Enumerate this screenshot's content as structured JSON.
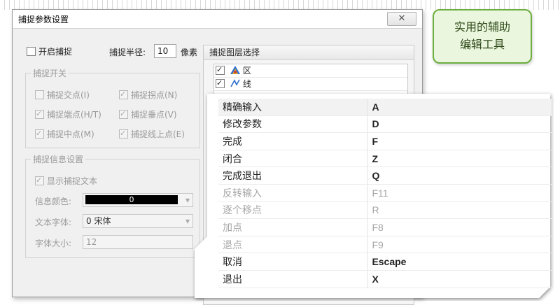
{
  "dialog": {
    "title": "捕捉参数设置",
    "close_label": "✕",
    "enable_snap_label": "开启捕捉",
    "radius_label": "捕捉半径:",
    "radius_value": "10",
    "radius_unit": "像素",
    "switch_group_label": "捕捉开关",
    "options": [
      {
        "label": "捕捉交点(I)",
        "checked": false
      },
      {
        "label": "捕捉拐点(N)",
        "checked": true
      },
      {
        "label": "捕捉端点(H/T)",
        "checked": true
      },
      {
        "label": "捕捉垂点(V)",
        "checked": true
      },
      {
        "label": "捕捉中点(M)",
        "checked": true
      },
      {
        "label": "捕捉线上点(E)",
        "checked": true
      }
    ],
    "info_group_label": "捕捉信息设置",
    "show_text_label": "显示捕捉文本",
    "info_color_label": "信息颜色:",
    "info_color_value": "0",
    "font_label": "文本字体:",
    "font_value": "0 宋体",
    "font_size_label": "字体大小:",
    "font_size_value": "12",
    "layer_panel_title": "捕捉图层选择",
    "layers": [
      {
        "label": "区",
        "icon": "region-icon"
      },
      {
        "label": "线",
        "icon": "line-icon"
      }
    ]
  },
  "callout": {
    "line1": "实用的辅助",
    "line2": "编辑工具"
  },
  "shortcuts": [
    {
      "name": "精确输入",
      "key": "A",
      "enabled": true
    },
    {
      "name": "修改参数",
      "key": "D",
      "enabled": true
    },
    {
      "name": "完成",
      "key": "F",
      "enabled": true
    },
    {
      "name": "闭合",
      "key": "Z",
      "enabled": true
    },
    {
      "name": "完成退出",
      "key": "Q",
      "enabled": true
    },
    {
      "name": "反转输入",
      "key": "F11",
      "enabled": false
    },
    {
      "name": "逐个移点",
      "key": "R",
      "enabled": false
    },
    {
      "name": "加点",
      "key": "F8",
      "enabled": false
    },
    {
      "name": "退点",
      "key": "F9",
      "enabled": false
    },
    {
      "name": "取消",
      "key": "Escape",
      "enabled": true
    },
    {
      "name": "退出",
      "key": "X",
      "enabled": true
    }
  ],
  "colors": {
    "callout_border": "#6cae3f",
    "callout_fill": "#eaf6dd"
  }
}
